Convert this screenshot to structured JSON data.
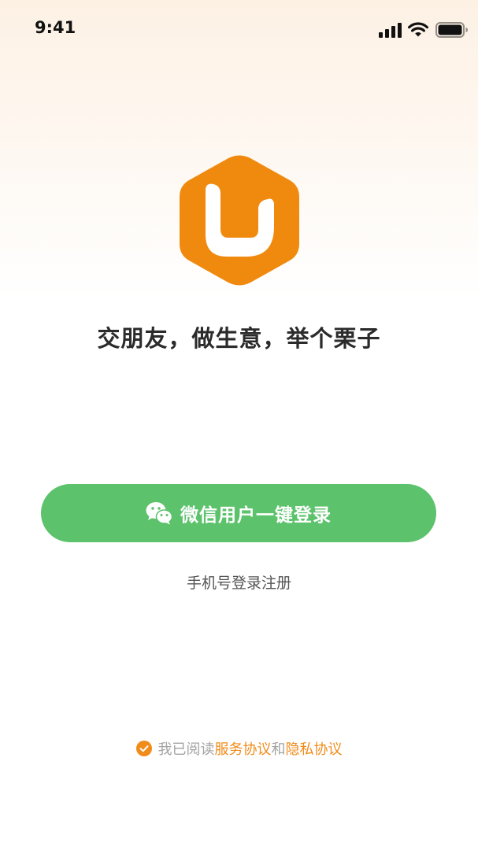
{
  "status_bar": {
    "time": "9:41",
    "icons": [
      "signal-icon",
      "wifi-icon",
      "battery-icon"
    ]
  },
  "logo": {
    "icon": "hexagon-logo-icon",
    "color": "#F08A0F"
  },
  "slogan": "交朋友，做生意，举个栗子",
  "wechat_login": {
    "icon": "wechat-icon",
    "label": "微信用户一键登录",
    "color": "#5CC26C"
  },
  "phone_login": {
    "label": "手机号登录注册"
  },
  "agreement": {
    "checked": true,
    "prefix": "我已阅读",
    "terms_label": "服务协议",
    "conjunction": "和",
    "privacy_label": "隐私协议",
    "accent_color": "#F08C1A"
  }
}
